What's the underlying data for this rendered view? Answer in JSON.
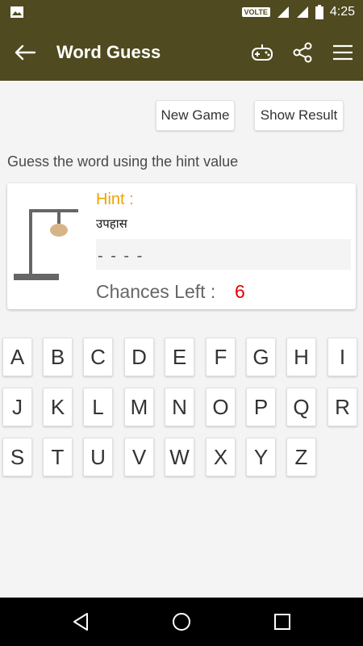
{
  "status_bar": {
    "time": "4:25",
    "volte_label": "VOLTE"
  },
  "app_bar": {
    "title": "Word Guess"
  },
  "buttons": {
    "new_game": "New Game",
    "show_result": "Show Result"
  },
  "instruction": "Guess the word using the hint value",
  "hint": {
    "label": "Hint :",
    "value": "उपहास",
    "word_display": "- - - -",
    "chances_label": "Chances Left :",
    "chances_value": "6"
  },
  "keyboard": {
    "row1": [
      "A",
      "B",
      "C",
      "D",
      "E",
      "F",
      "G",
      "H",
      "I"
    ],
    "row2": [
      "J",
      "K",
      "L",
      "M",
      "N",
      "O",
      "P",
      "Q",
      "R"
    ],
    "row3": [
      "S",
      "T",
      "U",
      "V",
      "W",
      "X",
      "Y",
      "Z"
    ]
  },
  "colors": {
    "app_bar": "#4f4a1f",
    "hint_label": "#f0a300",
    "chances_value": "#e00000",
    "background": "#f4f4f4"
  },
  "icons": {
    "status_left": "image-icon",
    "back": "arrow-left-icon",
    "game": "gamepad-icon",
    "share": "share-icon",
    "menu": "menu-icon"
  }
}
